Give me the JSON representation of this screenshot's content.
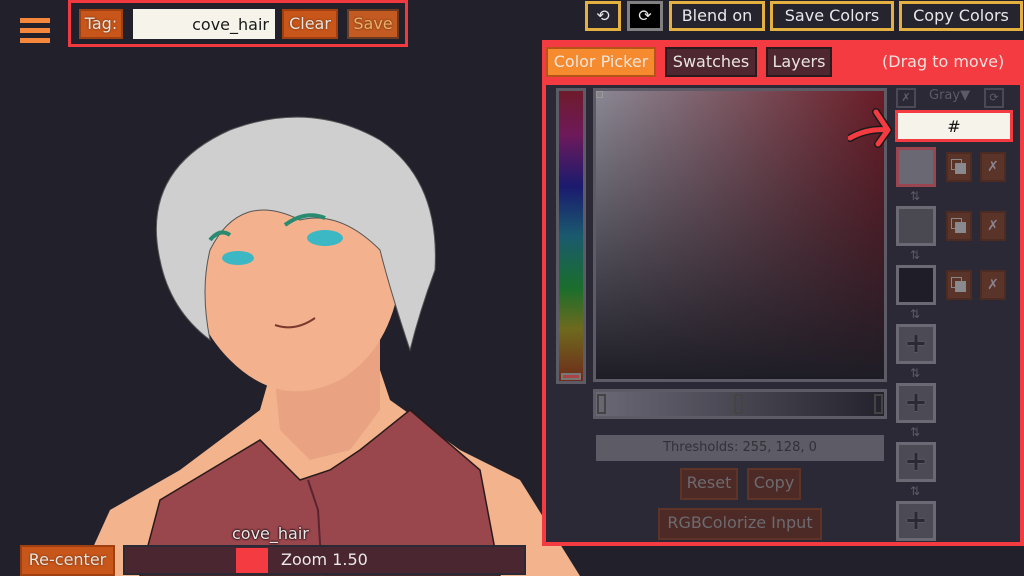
{
  "menu": {
    "icon": "hamburger-menu-icon"
  },
  "tag_bar": {
    "label": "Tag:",
    "value": "cove_hair",
    "clear_label": "Clear",
    "save_label": "Save"
  },
  "toolbar": {
    "undo_icon": "⟲",
    "redo_icon": "⟳",
    "blend_label": "Blend on",
    "save_colors_label": "Save Colors",
    "copy_colors_label": "Copy Colors"
  },
  "panel": {
    "tabs": [
      {
        "label": "Color Picker",
        "active": true
      },
      {
        "label": "Swatches",
        "active": false
      },
      {
        "label": "Layers",
        "active": false
      }
    ],
    "drag_hint": "(Drag to move)",
    "thresholds_label": "Thresholds: 255, 128, 0",
    "reset_label": "Reset",
    "copy_label": "Copy",
    "rgb_colorize_label": "RGBColorize Input",
    "gray_dropdown": "Gray▼",
    "clear_icon": "✗",
    "refresh_icon": "⟳",
    "hex_value": "#",
    "swatches": [
      {
        "color": "#6a6973",
        "selected": true
      },
      {
        "color": "#4a4952",
        "selected": false
      },
      {
        "color": "#1f1e28",
        "selected": false
      }
    ],
    "swatch_delete_icon": "✗",
    "swap_icon": "⇅",
    "add_icon": "+",
    "empty_slots": 4,
    "accent_color": "#f53b42"
  },
  "bottom": {
    "recenter_label": "Re-center",
    "layer_name": "cove_hair",
    "zoom_label": "Zoom 1.50"
  }
}
